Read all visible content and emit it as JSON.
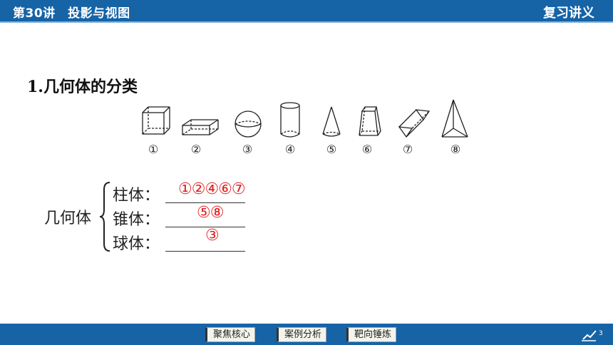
{
  "header": {
    "lesson_title": "第30讲　投影与视图",
    "section_name": "复习讲义"
  },
  "main": {
    "heading": "1.几何体的分类",
    "shape_labels": [
      "①",
      "②",
      "③",
      "④",
      "⑤",
      "⑥",
      "⑦",
      "⑧"
    ],
    "classification": {
      "group_label": "几何体",
      "rows": [
        {
          "label": "柱体：",
          "answer": "①②④⑥⑦"
        },
        {
          "label": "锥体：",
          "answer": "⑤⑧"
        },
        {
          "label": "球体：",
          "answer": "③"
        }
      ]
    },
    "answer_color": "#e02020"
  },
  "footer": {
    "buttons": [
      "聚焦核心",
      "案例分析",
      "靶向锤炼"
    ],
    "page_icon": "pen-page-icon",
    "page_number": "3"
  },
  "colors": {
    "header_bg": "#1663a6",
    "footer_bg": "#1663a6"
  }
}
